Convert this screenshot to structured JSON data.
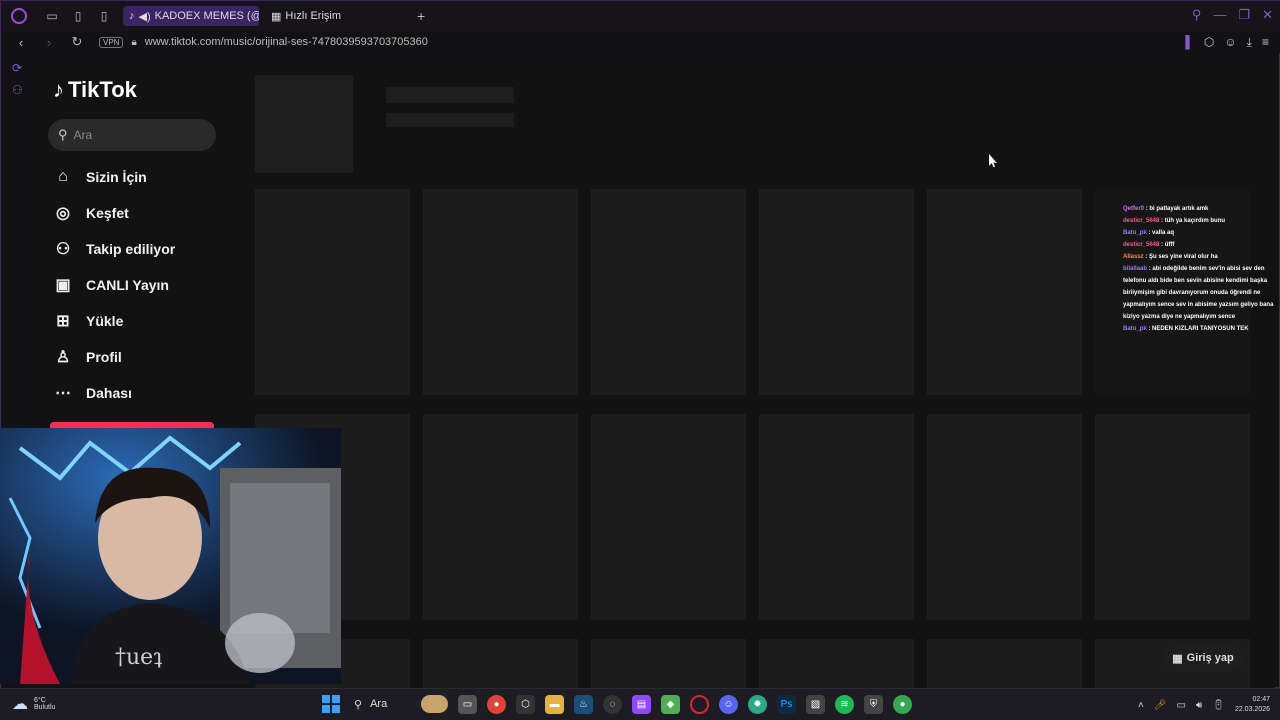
{
  "browser": {
    "tabs": [
      {
        "label": "KADOEX MEMES (@ka",
        "active": true
      },
      {
        "label": "Hızlı Erişim",
        "active": false
      }
    ],
    "new_tab": "+",
    "vpn": "VPN",
    "url": "www.tiktok.com/music/orijinal-ses-7478039593703705360"
  },
  "tiktok": {
    "logo": "TikTok",
    "search_placeholder": "Ara",
    "menu": [
      {
        "label": "Sizin İçin",
        "icon": "home-icon"
      },
      {
        "label": "Keşfet",
        "icon": "compass-icon"
      },
      {
        "label": "Takip ediliyor",
        "icon": "following-icon"
      },
      {
        "label": "CANLI Yayın",
        "icon": "live-icon"
      },
      {
        "label": "Yükle",
        "icon": "upload-icon"
      },
      {
        "label": "Profil",
        "icon": "profile-icon"
      },
      {
        "label": "Dahası",
        "icon": "more-icon"
      }
    ],
    "login_button": "Giriş yap"
  },
  "chat": [
    {
      "user": "Qetfer0",
      "text": ": bi patlayak artık amk"
    },
    {
      "user": "desticr_5648",
      "text": ": tüh ya kaçırdım bunu"
    },
    {
      "user": "Batu_pk",
      "text": ": valla aq"
    },
    {
      "user": "desticr_5648",
      "text": ": üfff"
    },
    {
      "user": "Allassz",
      "text": ": Şu ses yine viral olur ha"
    },
    {
      "user": "bilallaab",
      "text": ": abi odeğilde benim sev'in abisi sev den telefonu aldı bide ben sevin abisine kendimi başka biriiymişim gibi davranıyorum onuda öğrendi ne yapmalıyım sence sev in abisime yazsım geliyo bana kiziyo yazma diye ne yapmalıyım sence"
    },
    {
      "user": "Batu_pk",
      "text": ": NEDEN KIZLARI TANIYOSUN TEK"
    }
  ],
  "taskbar": {
    "weather_temp": "6°C",
    "weather_desc": "Bulutlu",
    "search_label": "Ara",
    "time": "02:47",
    "date": "22.03.2026"
  }
}
